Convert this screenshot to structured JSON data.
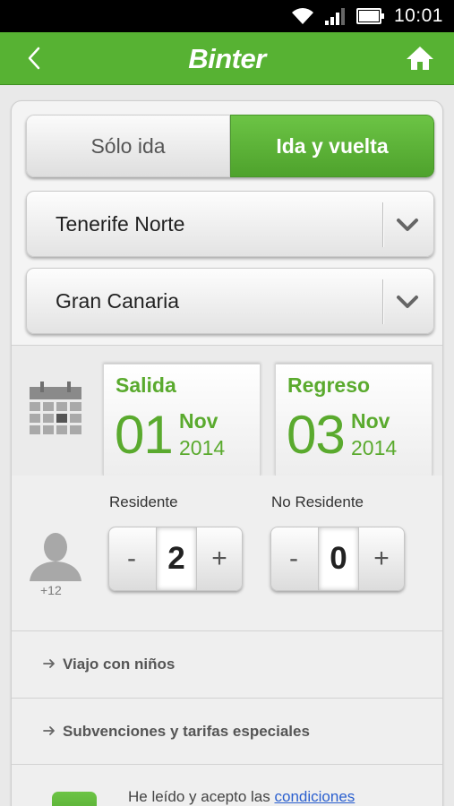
{
  "status_bar": {
    "time": "10:01"
  },
  "app_bar": {
    "brand": "Binter"
  },
  "trip_type": {
    "one_way": "Sólo ida",
    "round_trip": "Ida y vuelta",
    "selected": "round_trip"
  },
  "origin": {
    "value": "Tenerife Norte"
  },
  "destination": {
    "value": "Gran Canaria"
  },
  "dates": {
    "departure": {
      "label": "Salida",
      "day": "01",
      "month": "Nov",
      "year": "2014"
    },
    "return": {
      "label": "Regreso",
      "day": "03",
      "month": "Nov",
      "year": "2014"
    }
  },
  "passengers": {
    "age_label": "+12",
    "resident": {
      "label": "Residente",
      "count": "2",
      "minus": "-",
      "plus": "+"
    },
    "non_resident": {
      "label": "No Residente",
      "count": "0",
      "minus": "-",
      "plus": "+"
    }
  },
  "links": {
    "children": "Viajo con niños",
    "discounts": "Subvenciones y tarifas especiales"
  },
  "terms": {
    "text": "He leído y acepto las",
    "link": "condiciones"
  },
  "colors": {
    "brand_green": "#57b233",
    "accent_green": "#5aaa2e",
    "link_blue": "#2a5fcf"
  }
}
